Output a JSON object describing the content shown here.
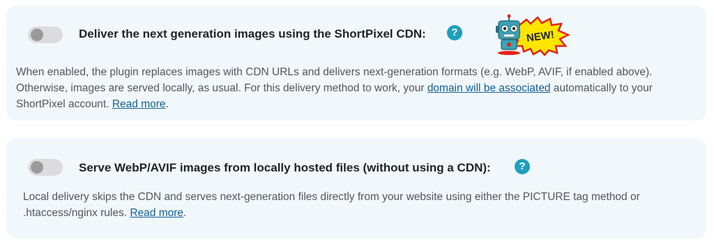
{
  "cdn_setting": {
    "title": "Deliver the next generation images using the ShortPixel CDN:",
    "help_glyph": "?",
    "toggle_on": false,
    "badge_text": "NEW!",
    "desc_part1": "When enabled, the plugin replaces images with CDN URLs and delivers next-generation formats (e.g. WebP, AVIF, if enabled above). Otherwise, images are served locally, as usual. For this delivery method to work, your ",
    "domain_link": "domain will be associated",
    "desc_part2": " automatically to your ShortPixel account. ",
    "read_more": "Read more",
    "desc_end": "."
  },
  "local_setting": {
    "title": "Serve WebP/AVIF images from locally hosted files (without using a CDN):",
    "help_glyph": "?",
    "toggle_on": false,
    "desc_part1": "Local delivery skips the CDN and serves next-generation files directly from your website using either the PICTURE tag method or .htaccess/nginx rules. ",
    "read_more": "Read more",
    "desc_end": "."
  },
  "colors": {
    "card_bg": "#f1f8fb",
    "help_icon": "#1ea0bf",
    "link": "#135e96",
    "badge_yellow": "#ffe600",
    "badge_red": "#e2231a",
    "robot_teal": "#3aa3b5"
  }
}
